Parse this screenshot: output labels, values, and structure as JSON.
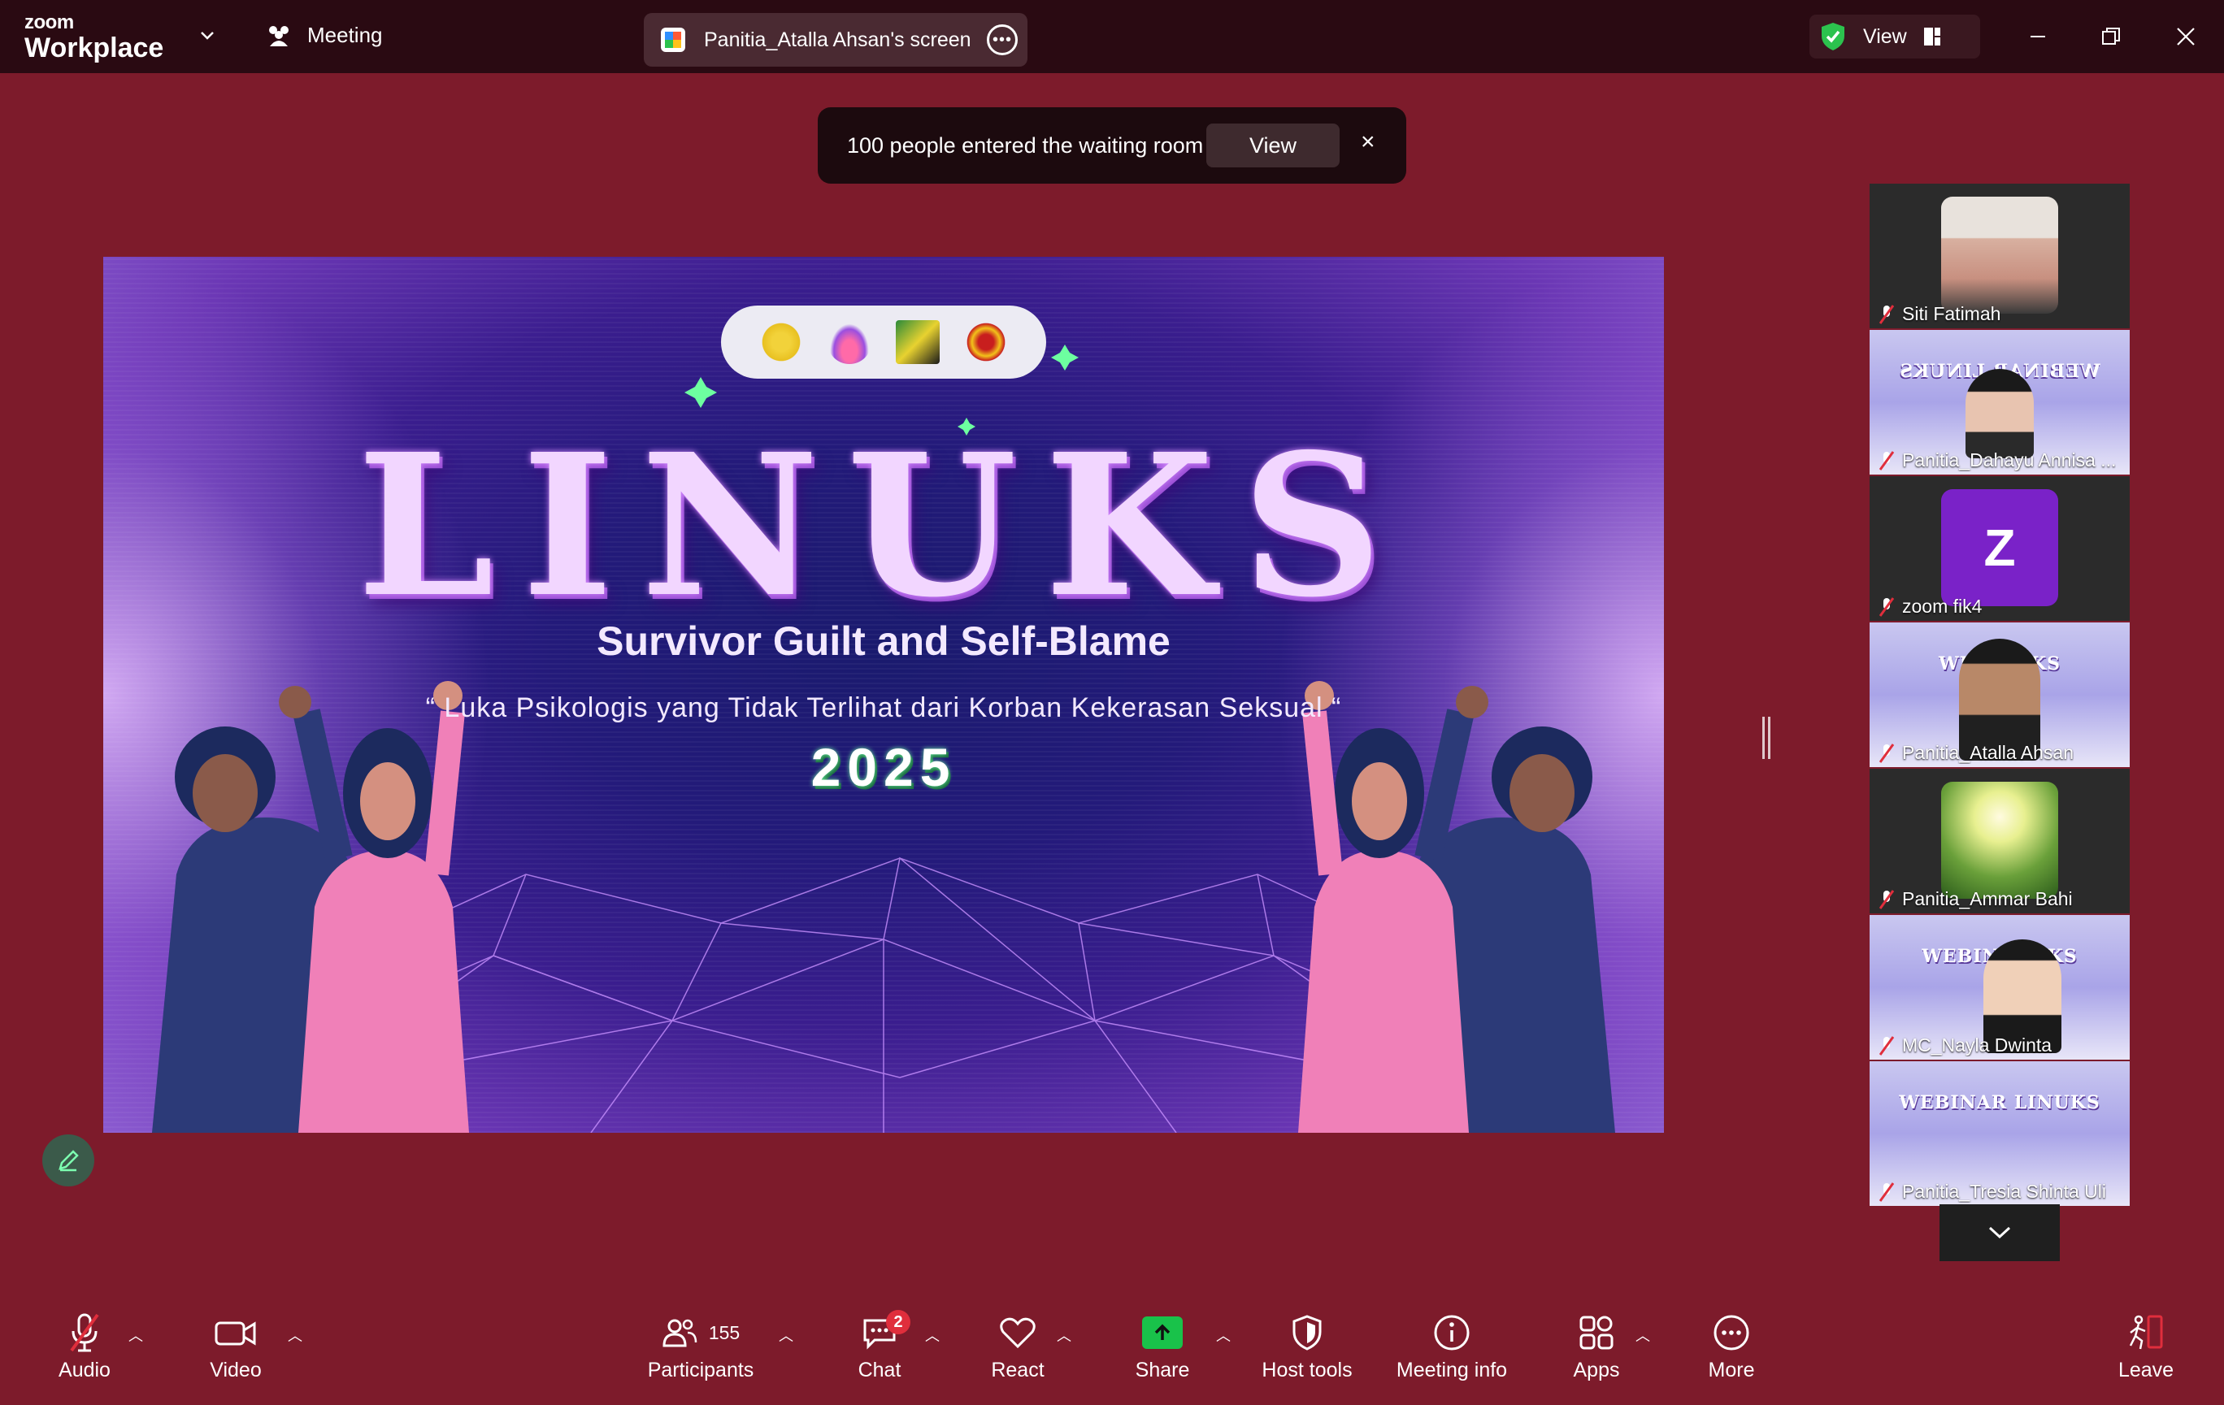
{
  "titlebar": {
    "brand_small": "zoom",
    "brand_big": "Workplace",
    "meeting_label": "Meeting",
    "shared_screen_label": "Panitia_Atalla Ahsan's screen",
    "view_label": "View"
  },
  "notification": {
    "text": "100 people entered the waiting room",
    "view_button": "View",
    "close_glyph": "×"
  },
  "slide": {
    "title": "LINUKS",
    "subtitle": "Survivor Guilt and Self-Blame",
    "tagline": "“ Luka Psikologis yang Tidak Terlihat dari Korban Kekerasan Seksual “",
    "year": "2025"
  },
  "participants": [
    {
      "name": "Siti Fatimah",
      "kind": "photo",
      "muted": true
    },
    {
      "name": "Panitia_Dahayu Annisa ...",
      "kind": "video",
      "muted": true,
      "active": true,
      "overlay": "WEBINAR LINUKS"
    },
    {
      "name": "zoom fik4",
      "kind": "avatar",
      "initial": "Z",
      "muted": true
    },
    {
      "name": "Panitia_Atalla Ahsan",
      "kind": "video",
      "muted": true,
      "overlay": "WEB        NUKS"
    },
    {
      "name": "Panitia_Ammar Bahi",
      "kind": "photo",
      "muted": true
    },
    {
      "name": "MC_Nayla Dwinta",
      "kind": "video",
      "muted": true,
      "overlay": "WEBINA      INKS"
    },
    {
      "name": "Panitia_Tresia Shinta Uli",
      "kind": "video",
      "muted": true,
      "overlay": "WEBINAR LINUKS"
    }
  ],
  "toolbar": {
    "audio": "Audio",
    "video": "Video",
    "participants": "Participants",
    "participants_count": "155",
    "chat": "Chat",
    "chat_badge": "2",
    "react": "React",
    "share": "Share",
    "host_tools": "Host tools",
    "meeting_info": "Meeting info",
    "apps": "Apps",
    "more": "More",
    "leave": "Leave"
  },
  "colors": {
    "background": "#7d1b2b",
    "titlebar": "#2a0a12",
    "active_speaker": "#2ef08a",
    "share_green": "#19c24a",
    "badge_red": "#e02e3c"
  }
}
